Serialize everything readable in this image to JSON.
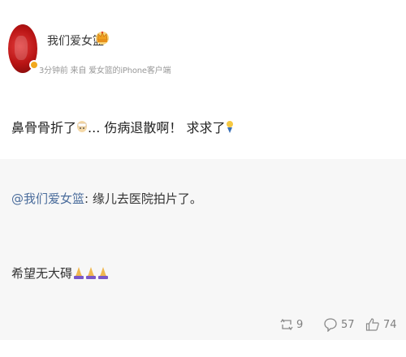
{
  "post": {
    "username": "我们爱女篮",
    "meta": "3分钟前 来自 爱女篮的iPhone客户端",
    "text_part1": "鼻骨骨折了",
    "text_part2": "... 伤病退散啊！ 求求了",
    "badge_icon": "crown-icon"
  },
  "repost": {
    "mention": "@我们爱女篮",
    "line_rest": ": 缘儿去医院拍片了。",
    "wish": "希望无大碍"
  },
  "actions": {
    "repost_count": "9",
    "comment_count": "57",
    "like_count": "74"
  },
  "colors": {
    "mention": "#4b6d9c",
    "meta": "#999999",
    "action": "#7f7f7f",
    "repost_bg": "#f7f7f7"
  }
}
